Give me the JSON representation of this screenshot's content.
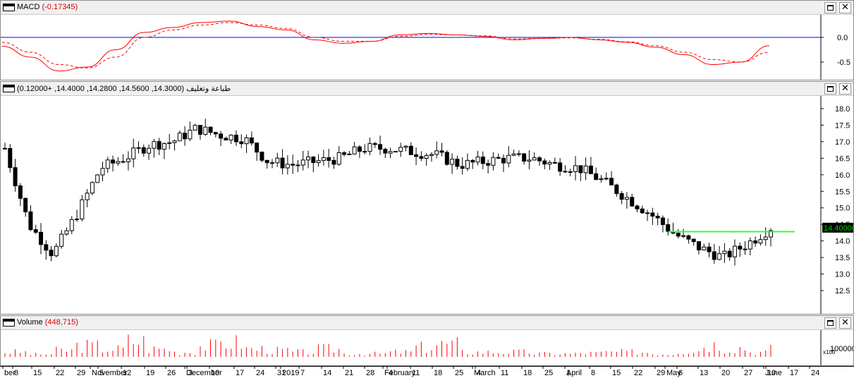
{
  "macd_pane": {
    "title": "MACD",
    "value": "(-0.17345)",
    "y_ticks": [
      "0.0",
      "-0.5"
    ]
  },
  "price_pane": {
    "title": "طباعة وتغليف",
    "ohlc": "(14.3000, 14.5600, 14.2800, 14.4000, +0.12000)",
    "y_ticks": [
      "18.0",
      "17.5",
      "17.0",
      "16.5",
      "16.0",
      "15.5",
      "15.0",
      "14.5",
      "14.0",
      "13.5",
      "13.0",
      "12.5"
    ],
    "last_price_label": "14.40000",
    "last_price_color": "#00cc00",
    "resistance_line_color": "#33ff33"
  },
  "volume_pane": {
    "title": "Volume",
    "value": "(448,715)",
    "y_tick": "100000",
    "multiplier": "x100"
  },
  "x_axis": {
    "labels": [
      "ber",
      "8",
      "15",
      "22",
      "29",
      "5",
      "November",
      "12",
      "19",
      "26",
      "3",
      "December",
      "10",
      "17",
      "24",
      "31",
      "2019",
      "7",
      "14",
      "21",
      "28",
      "4",
      "February",
      "11",
      "18",
      "25",
      "4",
      "March",
      "11",
      "18",
      "25",
      "1",
      "April",
      "8",
      "15",
      "22",
      "29",
      "6",
      "May",
      "13",
      "20",
      "27",
      "10",
      "June",
      "17",
      "24"
    ]
  },
  "chart_data": [
    {
      "type": "line",
      "title": "MACD",
      "series": [
        {
          "name": "MACD",
          "color": "#ff0000",
          "style": "solid",
          "values": [
            -0.18,
            -0.4,
            -0.68,
            -0.6,
            -0.25,
            0.1,
            0.2,
            0.3,
            0.33,
            0.22,
            0.15,
            -0.05,
            -0.12,
            -0.08,
            0.05,
            0.08,
            0.05,
            0.02,
            -0.05,
            -0.02,
            0.0,
            -0.05,
            -0.1,
            -0.2,
            -0.35,
            -0.55,
            -0.5,
            -0.17
          ]
        },
        {
          "name": "Signal",
          "color": "#ff0000",
          "style": "dashed",
          "values": [
            -0.1,
            -0.3,
            -0.55,
            -0.62,
            -0.4,
            0.0,
            0.15,
            0.25,
            0.3,
            0.25,
            0.18,
            0.0,
            -0.08,
            -0.08,
            0.02,
            0.06,
            0.05,
            0.03,
            -0.03,
            -0.02,
            -0.01,
            -0.04,
            -0.09,
            -0.17,
            -0.3,
            -0.45,
            -0.5,
            -0.3
          ]
        }
      ],
      "zero_line_color": "#0000ff",
      "ylim": [
        -0.8,
        0.4
      ]
    },
    {
      "type": "bar",
      "title": "Price candlesticks",
      "close_values": [
        16.8,
        14.5,
        13.6,
        14.8,
        16.2,
        16.5,
        16.9,
        17.0,
        17.4,
        17.2,
        17.1,
        16.4,
        16.3,
        16.4,
        16.5,
        16.8,
        16.8,
        16.7,
        16.6,
        16.3,
        16.4,
        16.5,
        16.5,
        16.3,
        16.2,
        15.8,
        15.3,
        14.8,
        14.2,
        13.8,
        13.5,
        13.9,
        14.4
      ],
      "resistance_level": 14.28,
      "last_price": 14.4,
      "ylim": [
        12.3,
        18.3
      ]
    },
    {
      "type": "bar",
      "title": "Volume",
      "values": [
        1.5,
        0.8,
        2.0,
        3.5,
        2.5,
        5.0,
        2.5,
        1.5,
        3.5,
        4.5,
        2.5,
        2.0,
        1.5,
        2.5,
        1.0,
        1.0,
        1.5,
        3.0,
        4.0,
        1.5,
        1.5,
        1.5,
        1.0,
        1.0,
        1.2,
        1.5,
        1.5,
        1.0,
        2.0,
        4.0,
        3.0,
        1.5,
        2.5
      ]
    }
  ]
}
